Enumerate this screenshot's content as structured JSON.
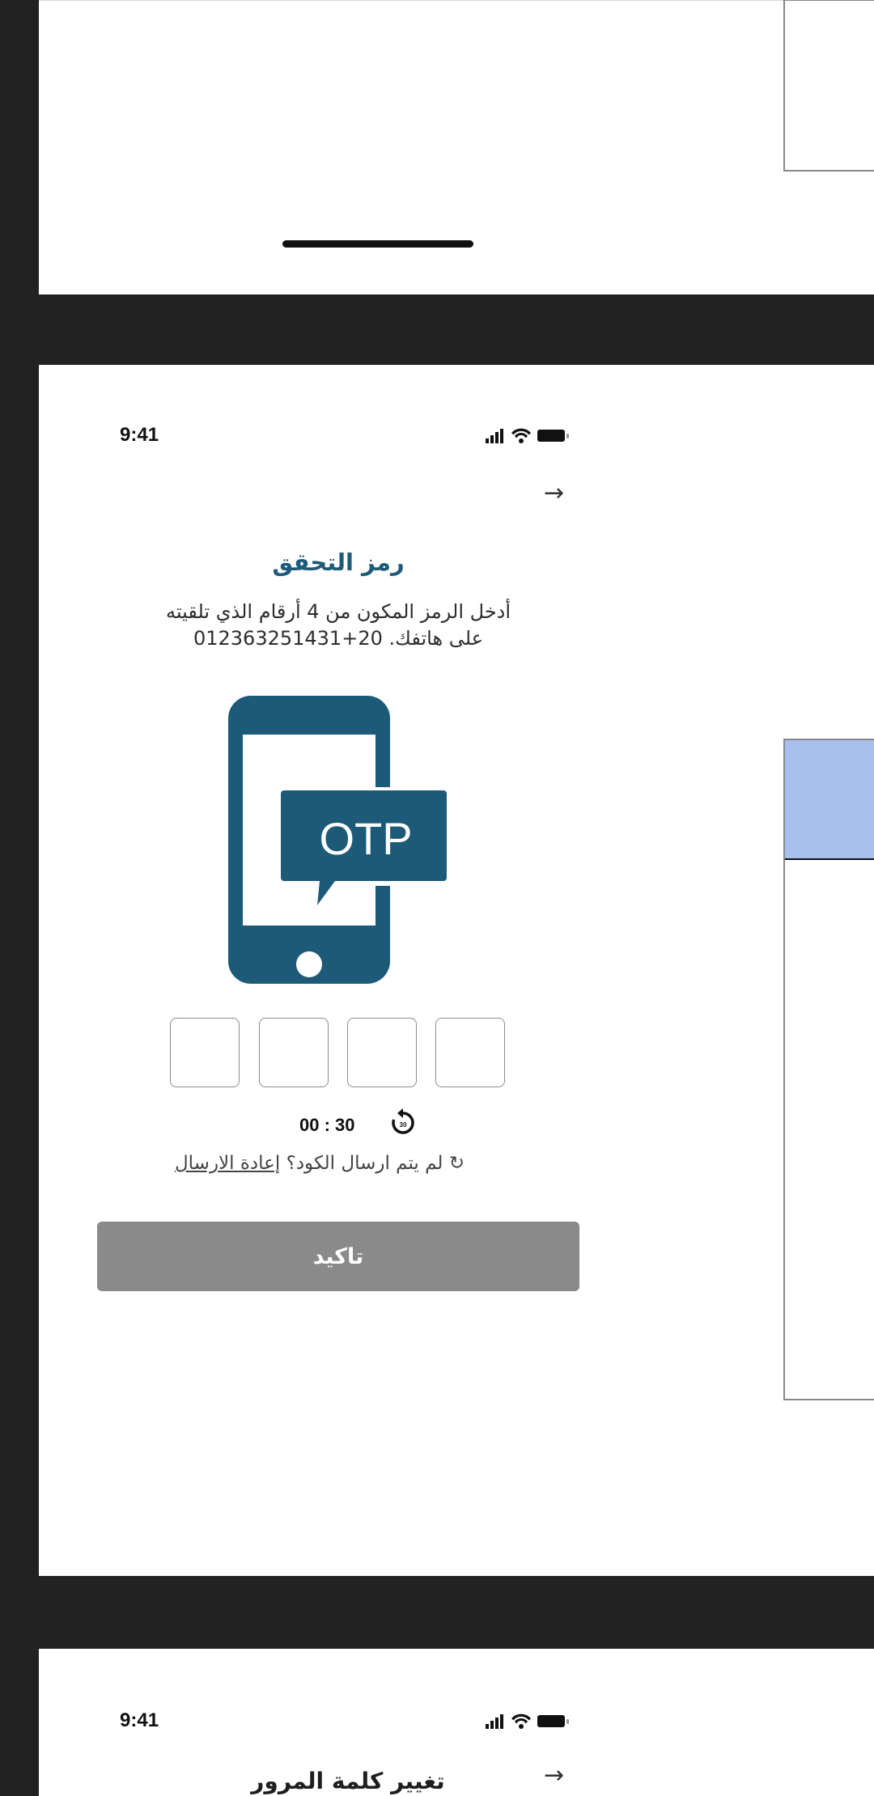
{
  "screen_otp": {
    "status": {
      "time": "9:41"
    },
    "title": "رمز التحقق",
    "description_line1": "أدخل الرمز المكون من 4 أرقام الذي تلقيته",
    "description_line2": "على هاتفك. 20+012363251431",
    "illustration_label": "OTP",
    "timer": "00 : 30",
    "resend_question": "لم يتم ارسال الكود؟",
    "resend_link": "إعادة الارسال",
    "confirm_button": "تاكيد"
  },
  "screen_change_password": {
    "status": {
      "time": "9:41"
    },
    "title": "تغيير كلمة المرور"
  },
  "colors": {
    "brand": "#1d5a78",
    "button_disabled": "#8a8a8a",
    "panel_highlight": "#a8c0ee"
  }
}
